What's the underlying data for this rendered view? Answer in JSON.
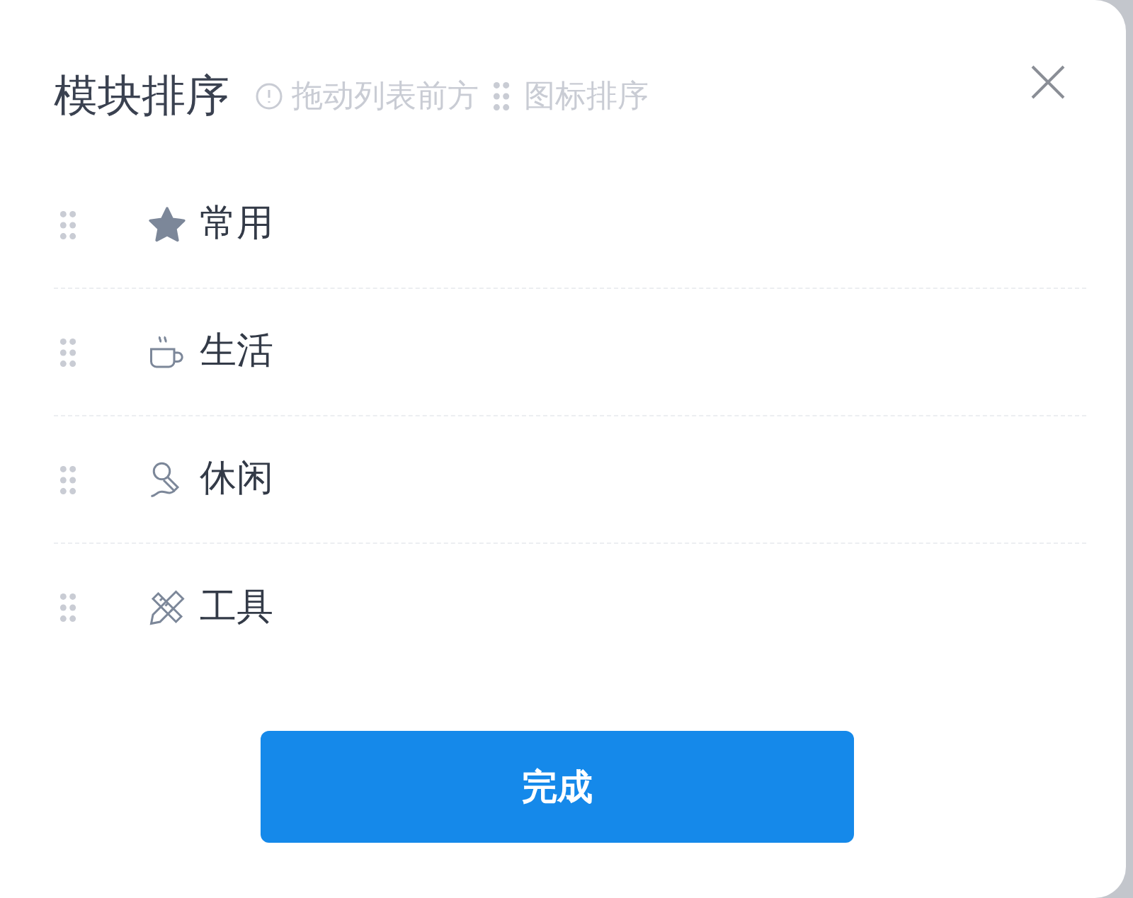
{
  "dialog": {
    "title": "模块排序",
    "hint_before": "拖动列表前方",
    "hint_after": "图标排序"
  },
  "items": [
    {
      "label": "常用",
      "kind": "star"
    },
    {
      "label": "生活",
      "kind": "cup"
    },
    {
      "label": "休闲",
      "kind": "microphone"
    },
    {
      "label": "工具",
      "kind": "tools"
    }
  ],
  "button": "完成"
}
